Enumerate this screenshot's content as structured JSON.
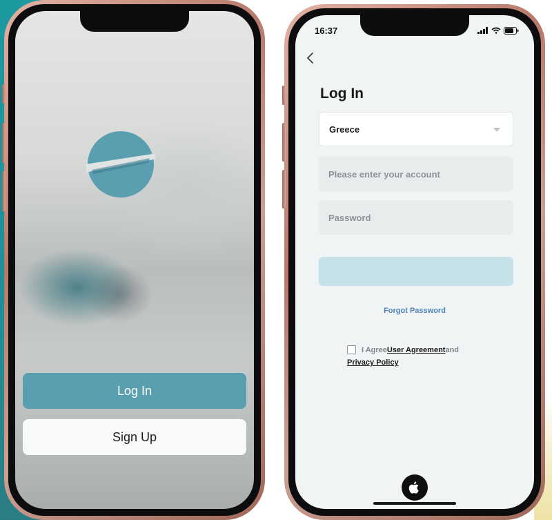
{
  "left_screen": {
    "login_label": "Log In",
    "signup_label": "Sign Up",
    "logo_icon": "app-logo-icon"
  },
  "right_screen": {
    "status": {
      "time": "16:37",
      "icons": [
        "signal-icon",
        "wifi-icon",
        "battery-icon"
      ]
    },
    "title": "Log In",
    "region_select": {
      "value": "Greece"
    },
    "account_field": {
      "placeholder": "Please enter your account",
      "value": ""
    },
    "password_field": {
      "placeholder": "Password",
      "value": ""
    },
    "submit_label": "",
    "forgot_password": "Forgot Password",
    "agreement": {
      "prefix": "I Agree",
      "user_agreement": "User Agreement",
      "conjunction": "and",
      "privacy_policy": "Privacy Policy"
    },
    "apple_login_icon": "apple-icon"
  },
  "colors": {
    "accent": "#5a9fb0",
    "link": "#4d82b8",
    "frame": "#b7796a"
  }
}
